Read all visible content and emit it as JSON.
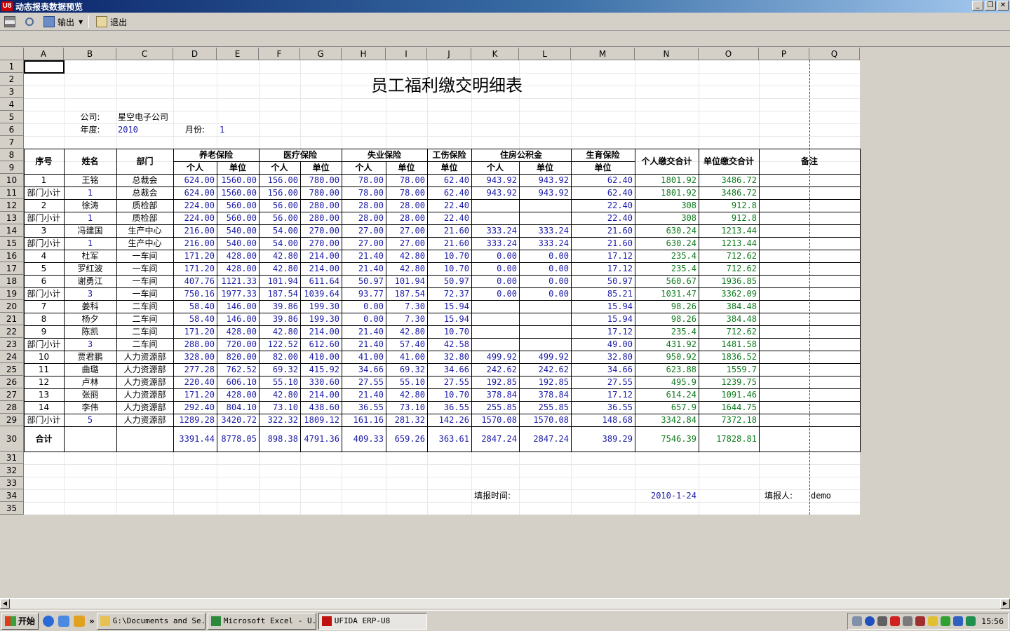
{
  "window": {
    "title": "动态报表数据预览",
    "app_icon_label": "U8"
  },
  "toolbar": {
    "export_label": "输出",
    "exit_label": "退出"
  },
  "columns": [
    "A",
    "B",
    "C",
    "D",
    "E",
    "F",
    "G",
    "H",
    "I",
    "J",
    "K",
    "L",
    "M",
    "N",
    "O",
    "P",
    "Q"
  ],
  "rows": [
    "1",
    "2",
    "3",
    "4",
    "5",
    "6",
    "7",
    "8",
    "9",
    "10",
    "11",
    "12",
    "13",
    "14",
    "15",
    "16",
    "17",
    "18",
    "19",
    "20",
    "21",
    "22",
    "23",
    "24",
    "25",
    "26",
    "27",
    "28",
    "29",
    "30",
    "31",
    "32",
    "33",
    "34",
    "35"
  ],
  "report": {
    "title": "员工福利缴交明细表",
    "company_label": "公司:",
    "company_value": "星空电子公司",
    "year_label": "年度:",
    "year_value": "2010",
    "month_label": "月份:",
    "month_value": "1",
    "headers": {
      "seq": "序号",
      "name": "姓名",
      "dept": "部门",
      "pension": "养老保险",
      "medical": "医疗保险",
      "unemployment": "失业保险",
      "injury": "工伤保险",
      "housing": "住房公积金",
      "maternity": "生育保险",
      "personal_total": "个人缴交合计",
      "company_total": "单位缴交合计",
      "remarks": "备注",
      "personal": "个人",
      "company": "单位"
    },
    "rows": [
      [
        "1",
        "王铭",
        "总裁会",
        "624.00",
        "1560.00",
        "156.00",
        "780.00",
        "78.00",
        "78.00",
        "62.40",
        "943.92",
        "943.92",
        "62.40",
        "1801.92",
        "3486.72"
      ],
      [
        "部门小计",
        "1",
        "总裁会",
        "624.00",
        "1560.00",
        "156.00",
        "780.00",
        "78.00",
        "78.00",
        "62.40",
        "943.92",
        "943.92",
        "62.40",
        "1801.92",
        "3486.72"
      ],
      [
        "2",
        "徐涛",
        "质检部",
        "224.00",
        "560.00",
        "56.00",
        "280.00",
        "28.00",
        "28.00",
        "22.40",
        "",
        "",
        "22.40",
        "308",
        "912.8"
      ],
      [
        "部门小计",
        "1",
        "质检部",
        "224.00",
        "560.00",
        "56.00",
        "280.00",
        "28.00",
        "28.00",
        "22.40",
        "",
        "",
        "22.40",
        "308",
        "912.8"
      ],
      [
        "3",
        "冯建国",
        "生产中心",
        "216.00",
        "540.00",
        "54.00",
        "270.00",
        "27.00",
        "27.00",
        "21.60",
        "333.24",
        "333.24",
        "21.60",
        "630.24",
        "1213.44"
      ],
      [
        "部门小计",
        "1",
        "生产中心",
        "216.00",
        "540.00",
        "54.00",
        "270.00",
        "27.00",
        "27.00",
        "21.60",
        "333.24",
        "333.24",
        "21.60",
        "630.24",
        "1213.44"
      ],
      [
        "4",
        "杜军",
        "一车间",
        "171.20",
        "428.00",
        "42.80",
        "214.00",
        "21.40",
        "42.80",
        "10.70",
        "0.00",
        "0.00",
        "17.12",
        "235.4",
        "712.62"
      ],
      [
        "5",
        "罗红波",
        "一车间",
        "171.20",
        "428.00",
        "42.80",
        "214.00",
        "21.40",
        "42.80",
        "10.70",
        "0.00",
        "0.00",
        "17.12",
        "235.4",
        "712.62"
      ],
      [
        "6",
        "谢勇江",
        "一车间",
        "407.76",
        "1121.33",
        "101.94",
        "611.64",
        "50.97",
        "101.94",
        "50.97",
        "0.00",
        "0.00",
        "50.97",
        "560.67",
        "1936.85"
      ],
      [
        "部门小计",
        "3",
        "一车间",
        "750.16",
        "1977.33",
        "187.54",
        "1039.64",
        "93.77",
        "187.54",
        "72.37",
        "0.00",
        "0.00",
        "85.21",
        "1031.47",
        "3362.09"
      ],
      [
        "7",
        "姜科",
        "二车间",
        "58.40",
        "146.00",
        "39.86",
        "199.30",
        "0.00",
        "7.30",
        "15.94",
        "",
        "",
        "15.94",
        "98.26",
        "384.48"
      ],
      [
        "8",
        "杨夕",
        "二车间",
        "58.40",
        "146.00",
        "39.86",
        "199.30",
        "0.00",
        "7.30",
        "15.94",
        "",
        "",
        "15.94",
        "98.26",
        "384.48"
      ],
      [
        "9",
        "陈凯",
        "二车间",
        "171.20",
        "428.00",
        "42.80",
        "214.00",
        "21.40",
        "42.80",
        "10.70",
        "",
        "",
        "17.12",
        "235.4",
        "712.62"
      ],
      [
        "部门小计",
        "3",
        "二车间",
        "288.00",
        "720.00",
        "122.52",
        "612.60",
        "21.40",
        "57.40",
        "42.58",
        "",
        "",
        "49.00",
        "431.92",
        "1481.58"
      ],
      [
        "10",
        "贾君鹏",
        "人力资源部",
        "328.00",
        "820.00",
        "82.00",
        "410.00",
        "41.00",
        "41.00",
        "32.80",
        "499.92",
        "499.92",
        "32.80",
        "950.92",
        "1836.52"
      ],
      [
        "11",
        "曲璐",
        "人力资源部",
        "277.28",
        "762.52",
        "69.32",
        "415.92",
        "34.66",
        "69.32",
        "34.66",
        "242.62",
        "242.62",
        "34.66",
        "623.88",
        "1559.7"
      ],
      [
        "12",
        "卢林",
        "人力资源部",
        "220.40",
        "606.10",
        "55.10",
        "330.60",
        "27.55",
        "55.10",
        "27.55",
        "192.85",
        "192.85",
        "27.55",
        "495.9",
        "1239.75"
      ],
      [
        "13",
        "张丽",
        "人力资源部",
        "171.20",
        "428.00",
        "42.80",
        "214.00",
        "21.40",
        "42.80",
        "10.70",
        "378.84",
        "378.84",
        "17.12",
        "614.24",
        "1091.46"
      ],
      [
        "14",
        "李伟",
        "人力资源部",
        "292.40",
        "804.10",
        "73.10",
        "438.60",
        "36.55",
        "73.10",
        "36.55",
        "255.85",
        "255.85",
        "36.55",
        "657.9",
        "1644.75"
      ],
      [
        "部门小计",
        "5",
        "人力资源部",
        "1289.28",
        "3420.72",
        "322.32",
        "1809.12",
        "161.16",
        "281.32",
        "142.26",
        "1570.08",
        "1570.08",
        "148.68",
        "3342.84",
        "7372.18"
      ]
    ],
    "total": [
      "合计",
      "",
      "",
      "3391.44",
      "8778.05",
      "898.38",
      "4791.36",
      "409.33",
      "659.26",
      "363.61",
      "2847.24",
      "2847.24",
      "389.29",
      "7546.39",
      "17828.81"
    ],
    "fill_time_label": "填报时间:",
    "fill_time_value": "2010-1-24",
    "filler_label": "填报人:",
    "filler_value": "demo"
  },
  "taskbar": {
    "start_label": "开始",
    "more": "»",
    "tasks": [
      "G:\\Documents and Se...",
      "Microsoft Excel - U...",
      "UFIDA ERP-U8"
    ],
    "clock": "15:56"
  }
}
